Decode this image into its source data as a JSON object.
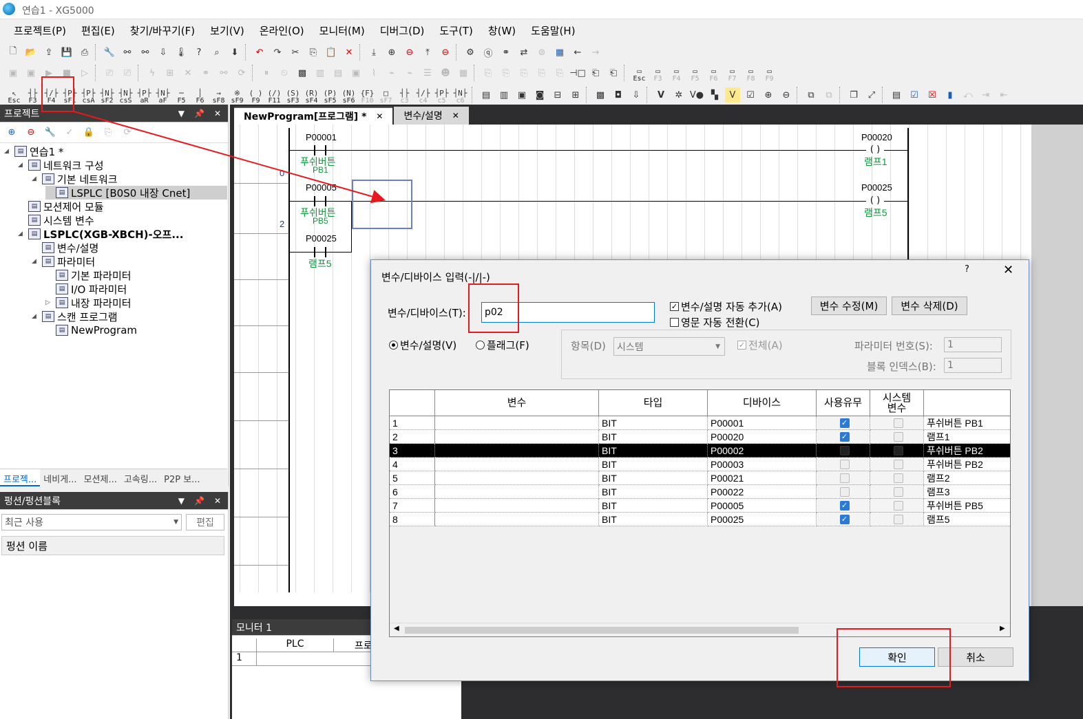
{
  "window": {
    "title": "연습1 - XG5000"
  },
  "menu": [
    "프로젝트(P)",
    "편집(E)",
    "찾기/바꾸기(F)",
    "보기(V)",
    "온라인(O)",
    "모니터(M)",
    "디버그(D)",
    "도구(T)",
    "창(W)",
    "도움말(H)"
  ],
  "fkeys": [
    {
      "k": "Esc",
      "g": "↖"
    },
    {
      "k": "F3",
      "g": "┤├"
    },
    {
      "k": "F4",
      "g": "┤/├"
    },
    {
      "k": "sF1",
      "g": "┤P├"
    },
    {
      "k": "csA",
      "g": "┤P├"
    },
    {
      "k": "sF2",
      "g": "┤N├"
    },
    {
      "k": "csS",
      "g": "┤N├"
    },
    {
      "k": "aR",
      "g": "┤P├"
    },
    {
      "k": "aF",
      "g": "┤N├"
    },
    {
      "k": "F5",
      "g": "─"
    },
    {
      "k": "F6",
      "g": "│"
    },
    {
      "k": "sF8",
      "g": "→"
    },
    {
      "k": "sF9",
      "g": "※"
    },
    {
      "k": "F9",
      "g": "( )"
    },
    {
      "k": "F11",
      "g": "(/)"
    },
    {
      "k": "sF3",
      "g": "(S)"
    },
    {
      "k": "sF4",
      "g": "(R)"
    },
    {
      "k": "sF5",
      "g": "(P)"
    },
    {
      "k": "sF6",
      "g": "(N)"
    },
    {
      "k": "F10",
      "g": "{F}"
    },
    {
      "k": "sF7",
      "g": "□"
    },
    {
      "k": "c3",
      "g": "┤├"
    },
    {
      "k": "c4",
      "g": "┤/├"
    },
    {
      "k": "c5",
      "g": "┤P├"
    },
    {
      "k": "c6",
      "g": "┤N├"
    }
  ],
  "fkeys2": [
    "Esc",
    "F3",
    "F4",
    "F5",
    "F6",
    "F7",
    "F8",
    "F9"
  ],
  "project_panel": {
    "title": "프로젝트",
    "tree": [
      {
        "label": "연습1 *",
        "level": 0,
        "exp": "◢"
      },
      {
        "label": "네트워크 구성",
        "level": 1,
        "exp": "◢"
      },
      {
        "label": "기본 네트워크",
        "level": 2,
        "exp": "◢"
      },
      {
        "label": "LSPLC [B0S0 내장 Cnet]",
        "level": 3,
        "exp": "",
        "sel": true
      },
      {
        "label": "모션제어 모듈",
        "level": 1,
        "exp": ""
      },
      {
        "label": "시스템 변수",
        "level": 1,
        "exp": ""
      },
      {
        "label": "LSPLC(XGB-XBCH)-오프...",
        "level": 1,
        "exp": "◢",
        "bold": true
      },
      {
        "label": "변수/설명",
        "level": 2,
        "exp": ""
      },
      {
        "label": "파라미터",
        "level": 2,
        "exp": "◢"
      },
      {
        "label": "기본 파라미터",
        "level": 3,
        "exp": ""
      },
      {
        "label": "I/O 파라미터",
        "level": 3,
        "exp": ""
      },
      {
        "label": "내장 파라미터",
        "level": 3,
        "exp": "▷"
      },
      {
        "label": "스캔 프로그램",
        "level": 2,
        "exp": "◢"
      },
      {
        "label": "NewProgram",
        "level": 3,
        "exp": ""
      }
    ],
    "tabs": [
      "프로젝...",
      "네비게...",
      "모션제...",
      "고속링...",
      "P2P 보..."
    ]
  },
  "func_panel": {
    "title": "펑션/펑션블록",
    "recent": "최근 사용",
    "edit": "편집",
    "name_header": "펑션 이름"
  },
  "doc_tabs": [
    {
      "label": "NewProgram[프로그램] *",
      "active": true
    },
    {
      "label": "변수/설명",
      "active": false
    }
  ],
  "ladder": {
    "row_nums": [
      "0",
      "2"
    ],
    "contacts": [
      {
        "addr": "P00001",
        "cmt": "푸쉬버튼",
        "cmt2": "PB1"
      },
      {
        "addr": "P00005",
        "cmt": "푸쉬버튼",
        "cmt2": "PB5"
      },
      {
        "addr": "P00025",
        "cmt": "램프5",
        "cmt2": ""
      }
    ],
    "coils": [
      {
        "addr": "P00020",
        "cmt": "램프1"
      },
      {
        "addr": "P00025",
        "cmt": "램프5"
      }
    ]
  },
  "monitor": {
    "title": "모니터 1",
    "col1": "PLC",
    "col2": "프로",
    "row1": "1"
  },
  "dialog": {
    "title": "변수/디바이스 입력(-|/|-)",
    "help": "?",
    "close": "✕",
    "device_label": "변수/디바이스(T):",
    "device_value": "p02",
    "auto_add": "변수/설명 자동 추가(A)",
    "eng_switch": "영문 자동 전환(C)",
    "modify_btn": "변수 수정(M)",
    "delete_btn": "변수 삭제(D)",
    "radio_var": "변수/설명(V)",
    "radio_flag": "플래그(F)",
    "item_label": "항목(D)",
    "item_value": "시스템",
    "all_label": "전체(A)",
    "param_label": "파라미터 번호(S):",
    "param_value": "1",
    "block_label": "블록 인덱스(B):",
    "block_value": "1",
    "ok": "확인",
    "cancel": "취소",
    "table": {
      "headers": [
        "",
        "변수",
        "타입",
        "디바이스",
        "사용유무",
        "시스템\n변수",
        ""
      ],
      "rows": [
        {
          "n": "1",
          "var": "",
          "type": "BIT",
          "dev": "P00001",
          "use": true,
          "sys": false,
          "cmt": "푸쉬버튼 PB1"
        },
        {
          "n": "2",
          "var": "",
          "type": "BIT",
          "dev": "P00020",
          "use": true,
          "sys": false,
          "cmt": "램프1"
        },
        {
          "n": "3",
          "var": "",
          "type": "BIT",
          "dev": "P00002",
          "use": false,
          "sys": false,
          "cmt": "푸쉬버튼 PB2",
          "sel": true
        },
        {
          "n": "4",
          "var": "",
          "type": "BIT",
          "dev": "P00003",
          "use": false,
          "sys": false,
          "cmt": "푸쉬버튼 PB2"
        },
        {
          "n": "5",
          "var": "",
          "type": "BIT",
          "dev": "P00021",
          "use": false,
          "sys": false,
          "cmt": "램프2"
        },
        {
          "n": "6",
          "var": "",
          "type": "BIT",
          "dev": "P00022",
          "use": false,
          "sys": false,
          "cmt": "램프3"
        },
        {
          "n": "7",
          "var": "",
          "type": "BIT",
          "dev": "P00005",
          "use": true,
          "sys": false,
          "cmt": "푸쉬버튼 PB5"
        },
        {
          "n": "8",
          "var": "",
          "type": "BIT",
          "dev": "P00025",
          "use": true,
          "sys": false,
          "cmt": "램프5"
        }
      ]
    }
  },
  "colors": {
    "annotation": "#e8191c",
    "accent": "#2a7ad8",
    "comment_green": "#0a9a3a"
  }
}
